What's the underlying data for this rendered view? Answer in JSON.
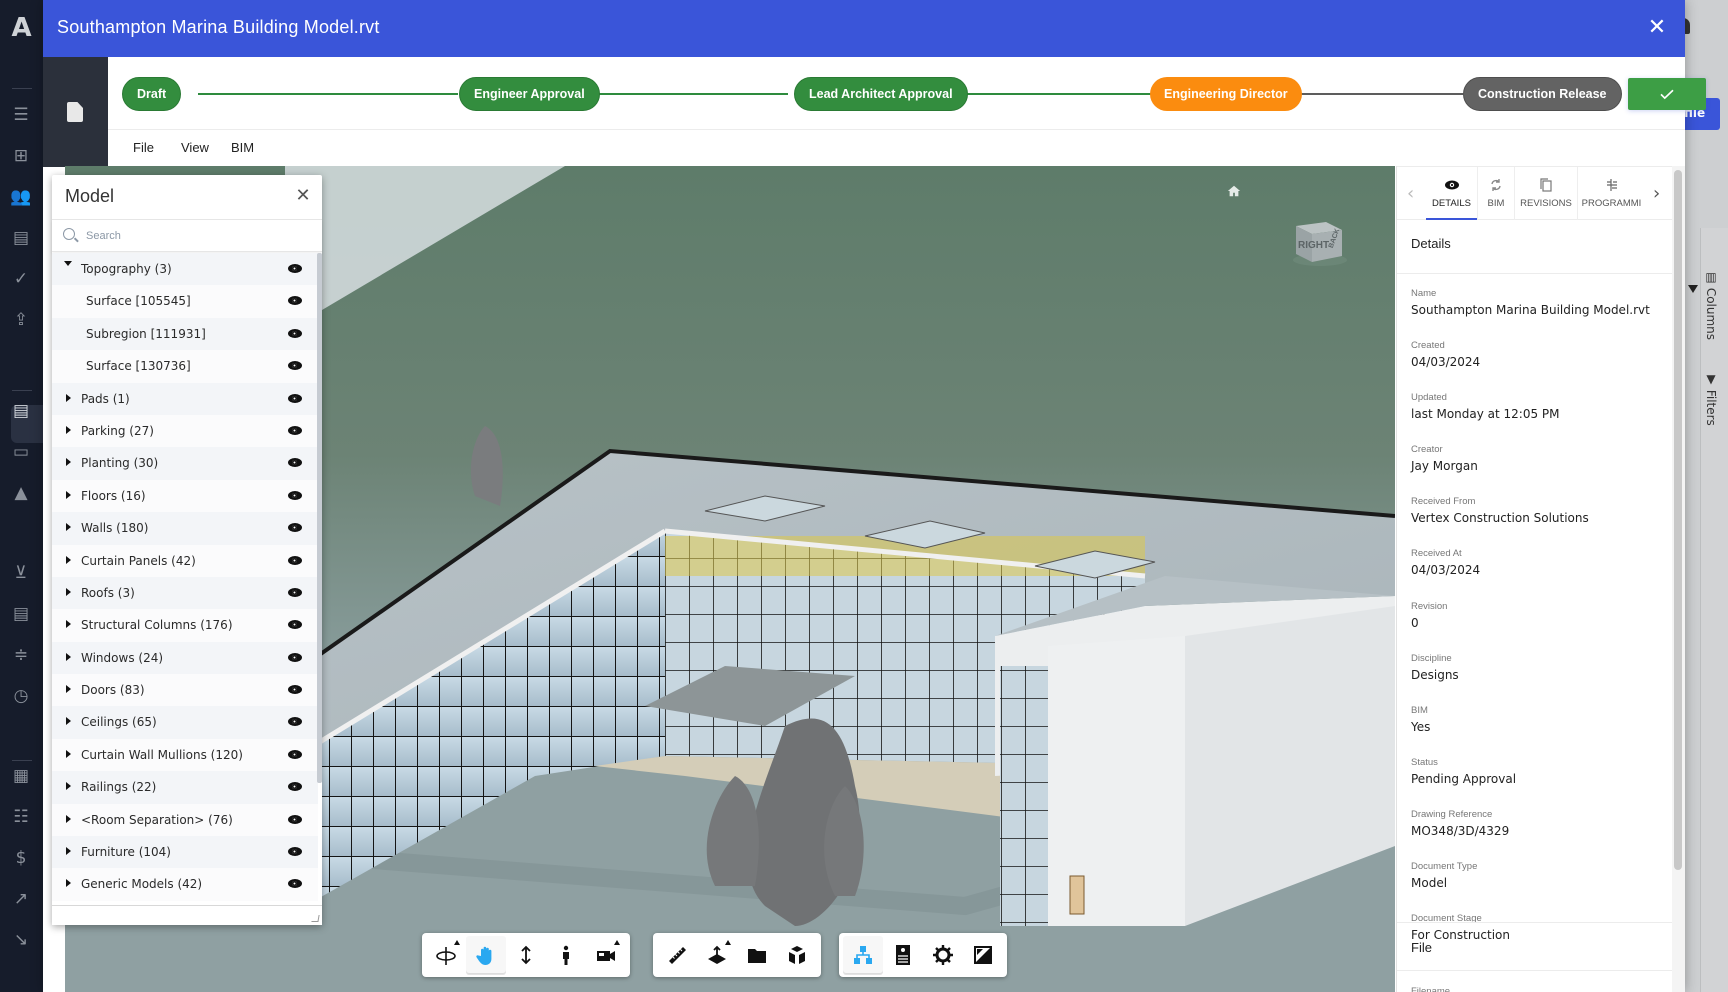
{
  "app": {
    "logo": "A",
    "sidebar_icons": [
      "list-icon",
      "hierarchy-icon",
      "people-icon",
      "document-icon",
      "check-icon",
      "file-upload-icon",
      "document-active-icon",
      "chat-icon",
      "warning-icon",
      "cart-icon",
      "invoice-icon",
      "split-icon",
      "clock-icon",
      "dashboard-icon",
      "table-icon",
      "dollar-icon",
      "trend-up-icon",
      "trend-down-icon"
    ],
    "background_button_label": "file",
    "background_rail": {
      "columns_label": "Columns",
      "filters_label": "Filters"
    }
  },
  "modal": {
    "title": "Southampton Marina Building Model.rvt",
    "close_icon": "close-icon"
  },
  "workflow": {
    "stages": [
      {
        "label": "Draft",
        "state": "done"
      },
      {
        "label": "Engineer Approval",
        "state": "done"
      },
      {
        "label": "Lead Architect Approval",
        "state": "done"
      },
      {
        "label": "Engineering Director",
        "state": "current"
      },
      {
        "label": "Construction Release",
        "state": "pending"
      }
    ],
    "approve_icon": "check-icon",
    "colors": {
      "done": "#338d3e",
      "current": "#fb8c0f",
      "pending": "#636363",
      "approve": "#3d9e45",
      "header": "#3a55d9"
    }
  },
  "menu": {
    "items": [
      "File",
      "View",
      "BIM"
    ]
  },
  "model_panel": {
    "title": "Model",
    "search_placeholder": "Search",
    "tree": [
      {
        "label": "Topography (3)",
        "expanded": true,
        "level": 0
      },
      {
        "label": "Surface [105545]",
        "level": 1
      },
      {
        "label": "Subregion [111931]",
        "level": 1
      },
      {
        "label": "Surface [130736]",
        "level": 1
      },
      {
        "label": "Pads (1)",
        "level": 0
      },
      {
        "label": "Parking (27)",
        "level": 0
      },
      {
        "label": "Planting (30)",
        "level": 0
      },
      {
        "label": "Floors (16)",
        "level": 0
      },
      {
        "label": "Walls (180)",
        "level": 0
      },
      {
        "label": "Curtain Panels (42)",
        "level": 0
      },
      {
        "label": "Roofs (3)",
        "level": 0
      },
      {
        "label": "Structural Columns (176)",
        "level": 0
      },
      {
        "label": "Windows (24)",
        "level": 0
      },
      {
        "label": "Doors (83)",
        "level": 0
      },
      {
        "label": "Ceilings (65)",
        "level": 0
      },
      {
        "label": "Curtain Wall Mullions (120)",
        "level": 0
      },
      {
        "label": "Railings (22)",
        "level": 0
      },
      {
        "label": "<Room Separation> (76)",
        "level": 0
      },
      {
        "label": "Furniture (104)",
        "level": 0
      },
      {
        "label": "Generic Models (42)",
        "level": 0
      }
    ]
  },
  "viewcube": {
    "faces": [
      "RIGHT",
      "BACK"
    ]
  },
  "toolbar": {
    "groups": [
      [
        {
          "name": "orbit-icon",
          "flyout": true
        },
        {
          "name": "pan-hand-icon",
          "active": true
        },
        {
          "name": "zoom-vertical-icon"
        },
        {
          "name": "first-person-icon"
        },
        {
          "name": "camera-icon",
          "flyout": true
        }
      ],
      [
        {
          "name": "measure-ruler-icon"
        },
        {
          "name": "section-plane-icon",
          "flyout": true
        },
        {
          "name": "folder-icon"
        },
        {
          "name": "explode-cube-icon"
        }
      ],
      [
        {
          "name": "model-browser-icon",
          "active": true
        },
        {
          "name": "properties-icon"
        },
        {
          "name": "settings-gear-icon"
        },
        {
          "name": "fullscreen-icon"
        }
      ]
    ]
  },
  "details_panel": {
    "tabs": [
      {
        "label": "DETAILS",
        "icon": "eye-icon",
        "active": true
      },
      {
        "label": "BIM",
        "icon": "sync-icon"
      },
      {
        "label": "REVISIONS",
        "icon": "copy-icon"
      },
      {
        "label": "PROGRAMMI",
        "icon": "programme-icon"
      }
    ],
    "heading": "Details",
    "fields": [
      {
        "label": "Name",
        "value": "Southampton Marina Building Model.rvt"
      },
      {
        "label": "Created",
        "value": "04/03/2024"
      },
      {
        "label": "Updated",
        "value": "last Monday at 12:05 PM"
      },
      {
        "label": "Creator",
        "value": "Jay Morgan"
      },
      {
        "label": "Received From",
        "value": "Vertex Construction Solutions"
      },
      {
        "label": "Received At",
        "value": "04/03/2024"
      },
      {
        "label": "Revision",
        "value": "0"
      },
      {
        "label": "Discipline",
        "value": "Designs"
      },
      {
        "label": "BIM",
        "value": "Yes"
      },
      {
        "label": "Status",
        "value": "Pending Approval"
      },
      {
        "label": "Drawing Reference",
        "value": "MO348/3D/4329"
      },
      {
        "label": "Document Type",
        "value": "Model"
      },
      {
        "label": "Document Stage",
        "value": "For Construction"
      }
    ],
    "file_heading": "File",
    "filename_label": "Filename"
  }
}
